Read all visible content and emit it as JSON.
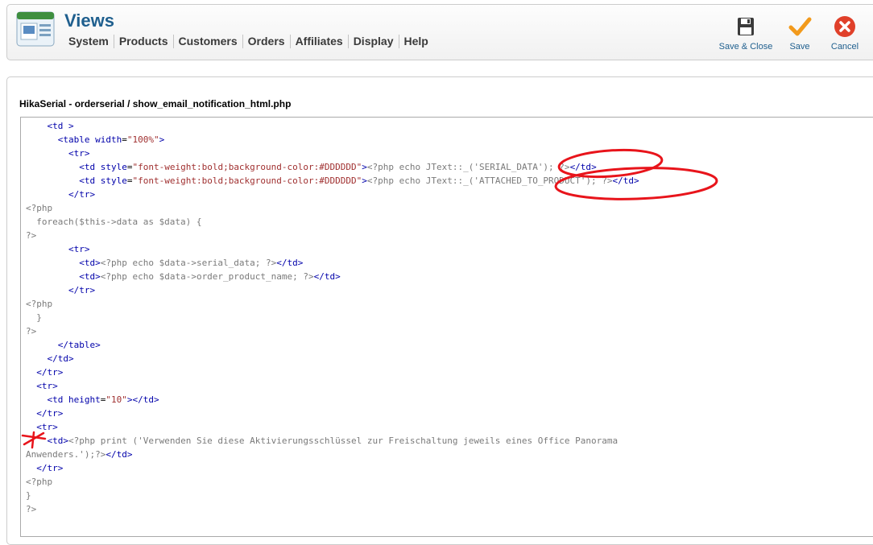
{
  "header": {
    "title": "Views",
    "menu": [
      "System",
      "Products",
      "Customers",
      "Orders",
      "Affiliates",
      "Display",
      "Help"
    ],
    "toolbar": {
      "save_close_label": "Save & Close",
      "save_label": "Save",
      "cancel_label": "Cancel"
    }
  },
  "content": {
    "file_label": "HikaSerial - orderserial / show_email_notification_html.php",
    "code_lines": [
      "    <td >",
      "      <table width=\"100%\">",
      "        <tr>",
      "          <td style=\"font-weight:bold;background-color:#DDDDDD\"><?php echo JText::_('SERIAL_DATA'); ?></td>",
      "          <td style=\"font-weight:bold;background-color:#DDDDDD\"><?php echo JText::_('ATTACHED_TO_PRODUCT'); ?></td>",
      "        </tr>",
      "<?php",
      "  foreach($this->data as $data) {",
      "?>",
      "        <tr>",
      "          <td><?php echo $data->serial_data; ?></td>",
      "          <td><?php echo $data->order_product_name; ?></td>",
      "        </tr>",
      "<?php",
      "  }",
      "?>",
      "      </table>",
      "    </td>",
      "  </tr>",
      "  <tr>",
      "    <td height=\"10\"></td>",
      "  </tr>",
      "  <tr>",
      "    <td><?php print ('Verwenden Sie diese Aktivierungsschlüssel zur Freischaltung jeweils eines Office Panorama",
      "Anwenders.');?></td>",
      "  </tr>",
      "<?php",
      "}",
      "?>"
    ]
  },
  "colors": {
    "title": "#1f5f8e",
    "tag": "#0000aa",
    "string": "#a03030",
    "php": "#7a7a7a",
    "annotation": "#e8141b"
  },
  "icons": [
    "views-logo-icon",
    "floppy-disk-icon",
    "checkmark-icon",
    "cancel-x-icon"
  ]
}
